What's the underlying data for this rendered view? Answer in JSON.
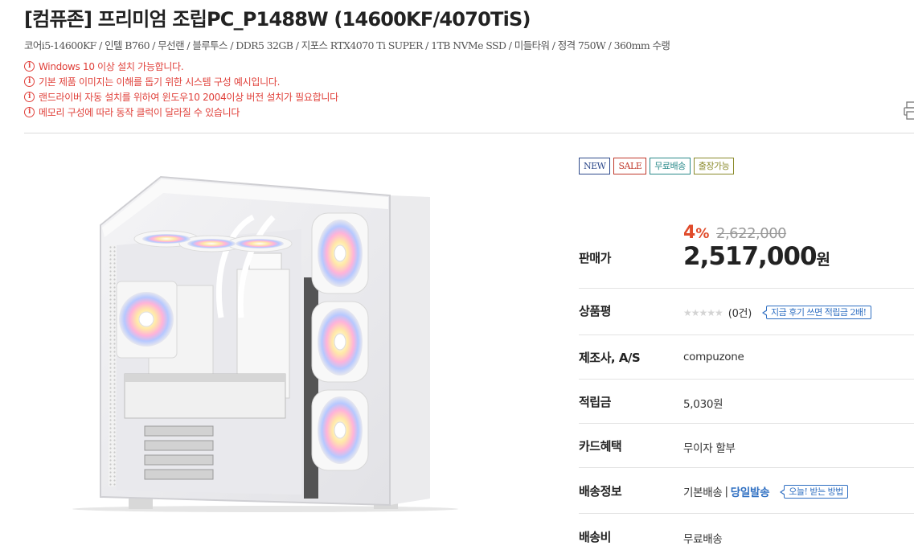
{
  "product": {
    "title": "[컴퓨존] 프리미엄 조립PC_P1488W (14600KF/4070TiS)",
    "spec_summary": "코어i5-14600KF / 인텔 B760 / 무선랜 / 블루투스 / DDR5 32GB / 지포스 RTX4070 Ti SUPER / 1TB NVMe SSD / 미들타워 / 정격 750W / 360mm 수랭",
    "notices": [
      "Windows 10 이상 설치 가능합니다.",
      "기본 제품 이미지는 이해를 돕기 위한 시스템 구성 예시입니다.",
      "랜드라이버 자동 설치를 위하여 윈도우10 2004이상 버전 설치가 필요합니다",
      "메모리 구성에 따라 동작 클럭이 달라질 수 있습니다"
    ],
    "notice_icon": "info-circle-icon",
    "print_icon": "print-icon",
    "image_alt": "white-mid-tower-pc-case-with-rgb-fans"
  },
  "badges": [
    {
      "label": "NEW",
      "color": "#2e4a8b"
    },
    {
      "label": "SALE",
      "color": "#c0392b"
    },
    {
      "label": "무료배송",
      "color": "#2a8a8a"
    },
    {
      "label": "출장가능",
      "color": "#8a8a2a"
    }
  ],
  "price": {
    "label": "판매가",
    "discount_rate": "4",
    "discount_unit": "%",
    "original": "2,622,000",
    "sale": "2,517,000",
    "currency": "원"
  },
  "info": {
    "review": {
      "label": "상품평",
      "stars": "★★★★★",
      "count": "(0건)",
      "tip": "지금 후기 쓰면 적립금 2배!",
      "rating": 0
    },
    "maker": {
      "label": "제조사, A/S",
      "value": "compuzone"
    },
    "points": {
      "label": "적립금",
      "value": "5,030원"
    },
    "card": {
      "label": "카드혜택",
      "value": "무이자 할부"
    },
    "shipping_info": {
      "label": "배송정보",
      "basic": "기본배송",
      "separator": "|",
      "sameday": "당일발송",
      "tip": "오늘! 받는 방법"
    },
    "shipping_fee": {
      "label": "배송비",
      "value": "무료배송"
    }
  },
  "colors": {
    "notice_red": "#e0403a",
    "discount_red": "#e04b2b",
    "link_blue": "#2f6fc2",
    "text_dark": "#222222"
  }
}
